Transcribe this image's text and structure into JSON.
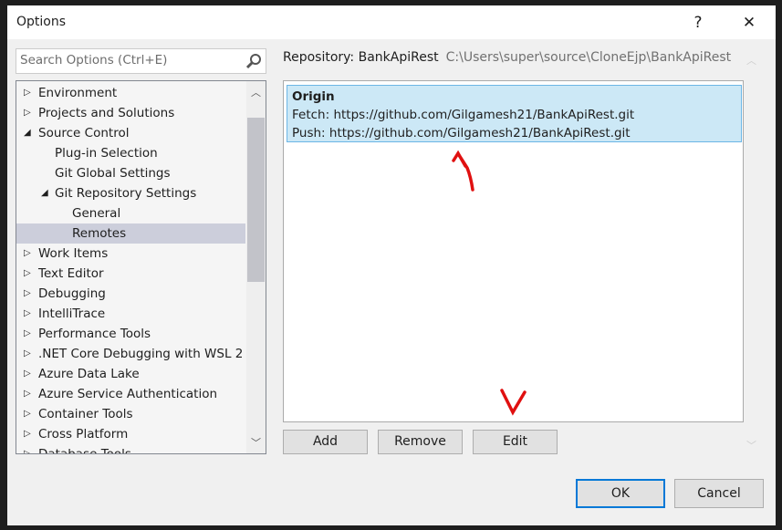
{
  "window": {
    "title": "Options",
    "help_label": "?",
    "close_label": "✕"
  },
  "search": {
    "placeholder": "Search Options (Ctrl+E)",
    "value": ""
  },
  "tree": {
    "items": [
      {
        "label": "Environment",
        "level": 0,
        "expander": "collapsed"
      },
      {
        "label": "Projects and Solutions",
        "level": 0,
        "expander": "collapsed"
      },
      {
        "label": "Source Control",
        "level": 0,
        "expander": "expanded"
      },
      {
        "label": "Plug-in Selection",
        "level": 1,
        "expander": "none"
      },
      {
        "label": "Git Global Settings",
        "level": 1,
        "expander": "none"
      },
      {
        "label": "Git Repository Settings",
        "level": 1,
        "expander": "expanded"
      },
      {
        "label": "General",
        "level": 2,
        "expander": "none"
      },
      {
        "label": "Remotes",
        "level": 2,
        "expander": "none",
        "selected": true
      },
      {
        "label": "Work Items",
        "level": 0,
        "expander": "collapsed"
      },
      {
        "label": "Text Editor",
        "level": 0,
        "expander": "collapsed"
      },
      {
        "label": "Debugging",
        "level": 0,
        "expander": "collapsed"
      },
      {
        "label": "IntelliTrace",
        "level": 0,
        "expander": "collapsed"
      },
      {
        "label": "Performance Tools",
        "level": 0,
        "expander": "collapsed"
      },
      {
        "label": ".NET Core Debugging with WSL 2",
        "level": 0,
        "expander": "collapsed"
      },
      {
        "label": "Azure Data Lake",
        "level": 0,
        "expander": "collapsed"
      },
      {
        "label": "Azure Service Authentication",
        "level": 0,
        "expander": "collapsed"
      },
      {
        "label": "Container Tools",
        "level": 0,
        "expander": "collapsed"
      },
      {
        "label": "Cross Platform",
        "level": 0,
        "expander": "collapsed"
      },
      {
        "label": "Database Tools",
        "level": 0,
        "expander": "collapsed"
      }
    ]
  },
  "repository": {
    "label": "Repository: BankApiRest",
    "path": "C:\\Users\\super\\source\\CloneEjp\\BankApiRest"
  },
  "remotes": [
    {
      "name": "Origin",
      "fetch": "Fetch: https://github.com/Gilgamesh21/BankApiRest.git",
      "push": "Push: https://github.com/Gilgamesh21/BankApiRest.git"
    }
  ],
  "buttons": {
    "add": "Add",
    "remove": "Remove",
    "edit": "Edit",
    "ok": "OK",
    "cancel": "Cancel"
  },
  "colors": {
    "selection": "#cce8f6",
    "tree_selection": "#cccedb",
    "annotation": "#e01010",
    "focus": "#0078d7"
  }
}
